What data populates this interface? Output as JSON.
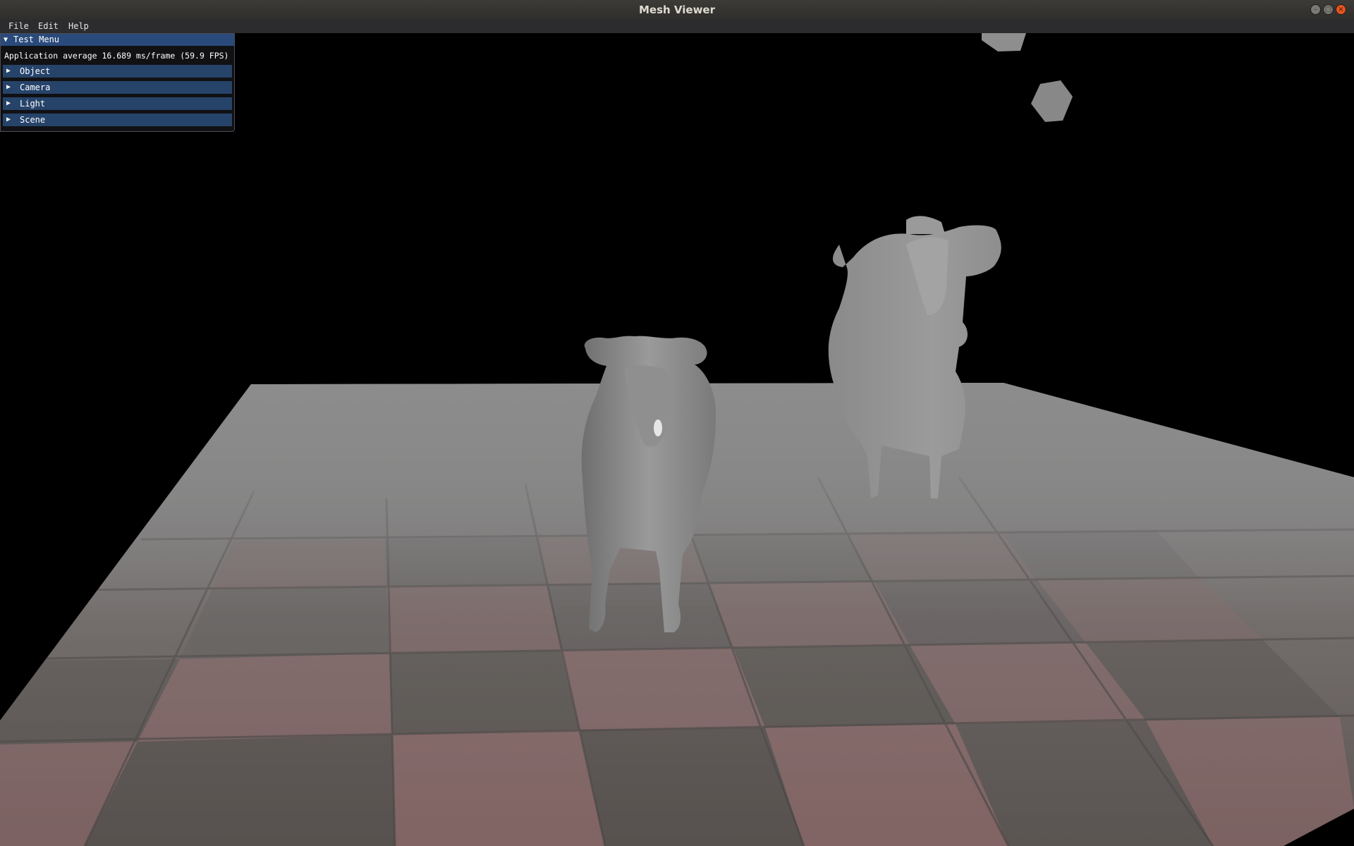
{
  "window": {
    "title": "Mesh Viewer",
    "controls": {
      "minimize_icon": "minimize-icon",
      "maximize_icon": "maximize-icon",
      "close_icon": "close-icon",
      "minimize_glyph": "–",
      "maximize_glyph": "□",
      "close_glyph": "×"
    }
  },
  "menubar": {
    "items": [
      {
        "label": "File"
      },
      {
        "label": "Edit"
      },
      {
        "label": "Help"
      }
    ]
  },
  "panel": {
    "title": "Test Menu",
    "expanded_glyph": "▼",
    "collapsed_glyph": "▶",
    "fps_text": "Application average 16.689 ms/frame (59.9 FPS)",
    "sections": [
      {
        "label": "Object"
      },
      {
        "label": "Camera"
      },
      {
        "label": "Light"
      },
      {
        "label": "Scene"
      }
    ]
  },
  "scene": {
    "background_color": "#000000",
    "floor_texture": "checkered-stone-tiles",
    "objects": [
      "cow-mesh",
      "cow-mesh",
      "floating-polyhedron",
      "floating-polyhedron"
    ]
  },
  "colors": {
    "panel_header": "#294a7a",
    "panel_row": "#26436a",
    "close_button": "#e9541f",
    "mesh_gray": "#8a8a8a"
  }
}
